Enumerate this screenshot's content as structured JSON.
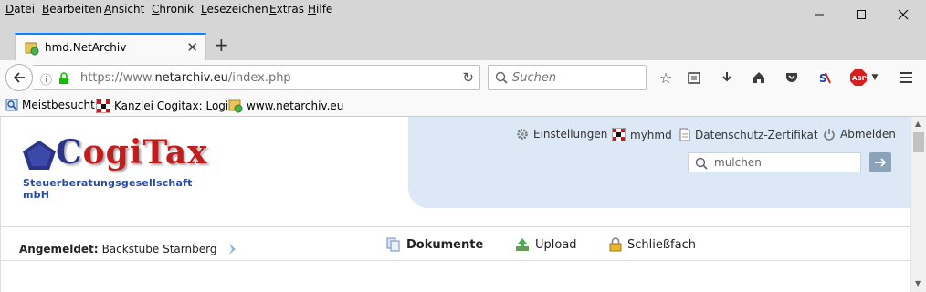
{
  "menubar": {
    "items": [
      "Datei",
      "Bearbeiten",
      "Ansicht",
      "Chronik",
      "Lesezeichen",
      "Extras",
      "Hilfe"
    ]
  },
  "window_controls": {
    "minimize_icon": "minimize-icon",
    "maximize_icon": "maximize-icon",
    "close_icon": "close-icon"
  },
  "tab": {
    "title": "hmd.NetArchiv",
    "new_tab_label": "+"
  },
  "navbar": {
    "url_scheme": "https://www.",
    "url_host": "netarchiv.eu",
    "url_path": "/index.php",
    "search_placeholder": "Suchen"
  },
  "bookmarks": {
    "items": [
      "Meistbesucht",
      "Kanzlei Cogitax: Login",
      "www.netarchiv.eu"
    ]
  },
  "page": {
    "logo": {
      "name": "CogiTax",
      "subtitle": "Steuerberatungsgesellschaft mbH"
    },
    "top_links": {
      "settings": "Einstellungen",
      "myhmd": "myhmd",
      "privacy": "Datenschutz-Zertifikat",
      "logout": "Abmelden"
    },
    "quick_search_placeholder": "mulchen",
    "user": {
      "label": "Angemeldet:",
      "name": "Backstube Starnberg"
    },
    "nav": {
      "documents": "Dokumente",
      "upload": "Upload",
      "locker": "Schließfach"
    }
  },
  "colors": {
    "accent": "#0a84ff",
    "panel": "#dce8f6",
    "logo_blue": "#2a348a",
    "logo_red": "#c01e1e"
  }
}
